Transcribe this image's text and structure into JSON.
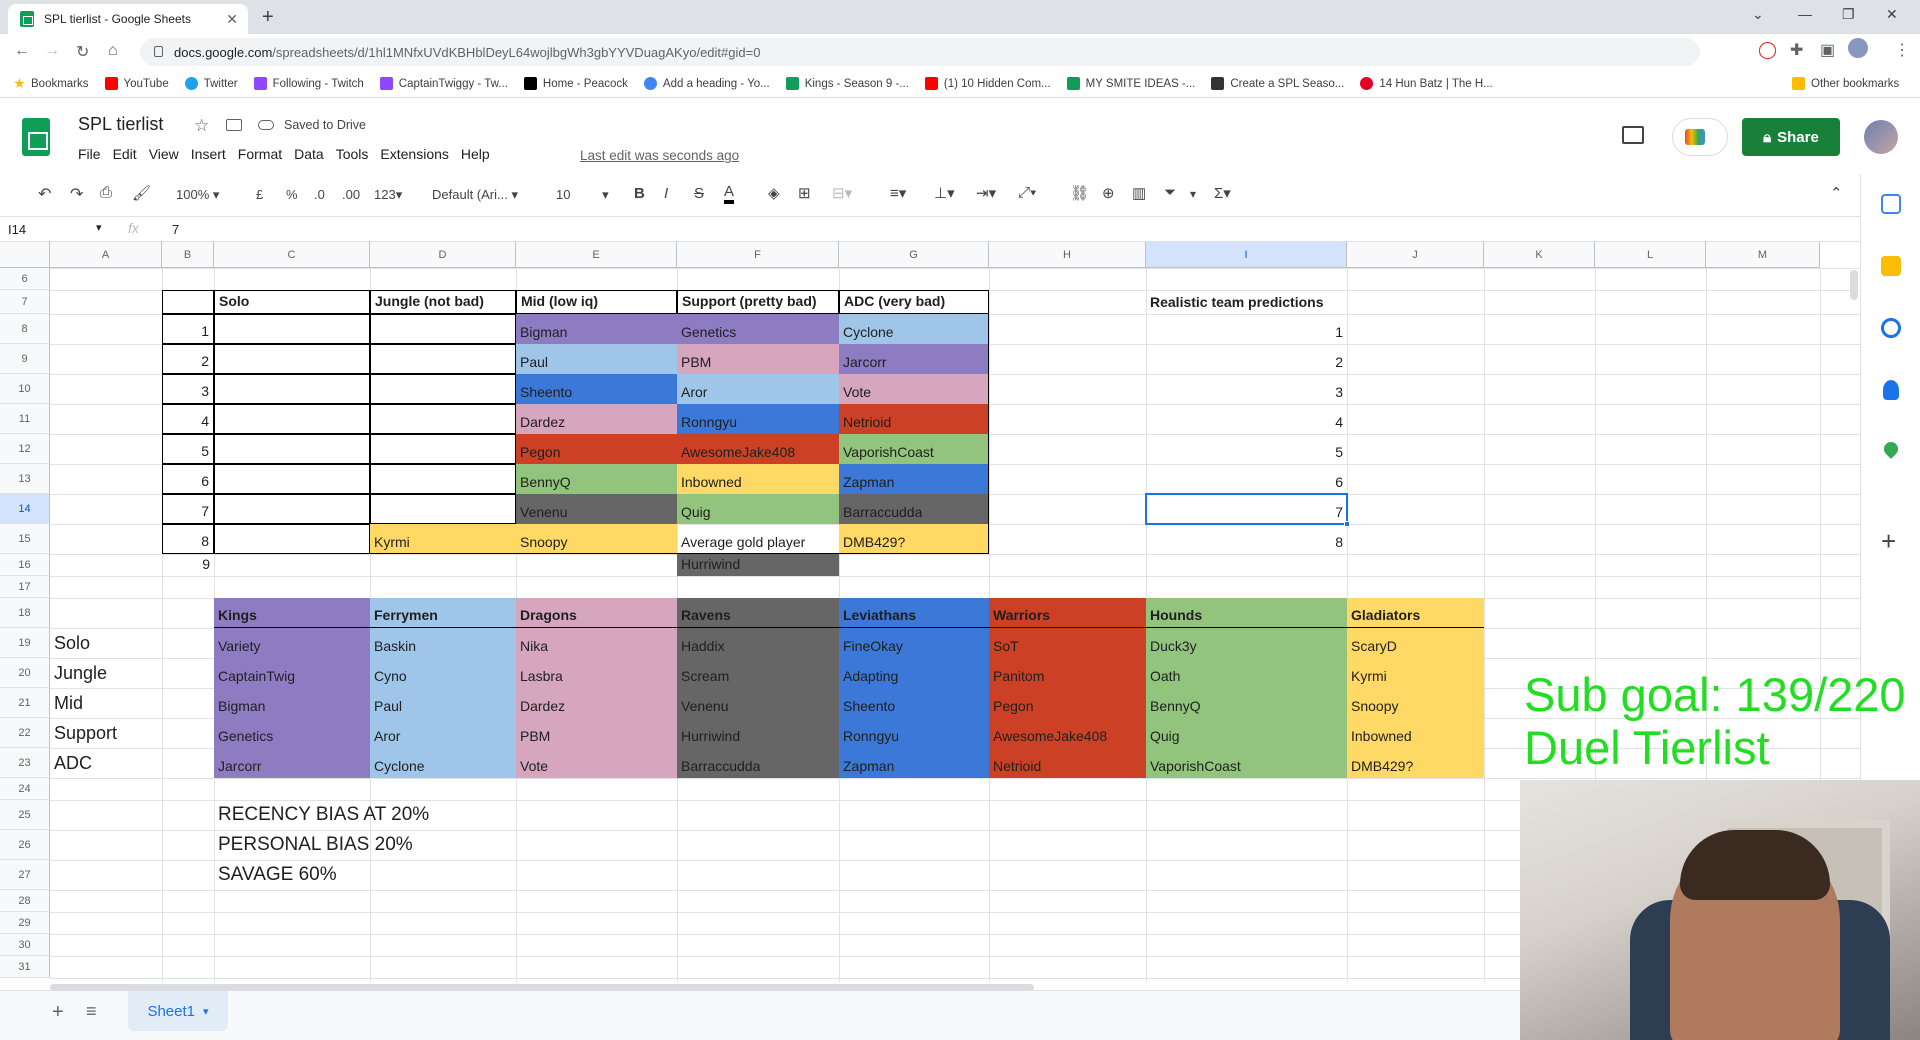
{
  "browser": {
    "tab_title": "SPL tierlist - Google Sheets",
    "url_host": "docs.google.com",
    "url_path": "/spreadsheets/d/1hl1MNfxUVdKBHblDeyL64wojlbgWh3gbYYVDuagAKyo/edit#gid=0",
    "bookmarks": [
      "Bookmarks",
      "YouTube",
      "Twitter",
      "Following - Twitch",
      "CaptainTwiggy - Tw...",
      "Home - Peacock",
      "Add a heading - Yo...",
      "Kings - Season 9 -...",
      "(1) 10 Hidden Com...",
      "MY SMITE IDEAS -...",
      "Create a SPL Seaso...",
      "14 Hun Batz | The H..."
    ],
    "other_bookmarks": "Other bookmarks"
  },
  "doc": {
    "title": "SPL tierlist",
    "saved": "Saved to Drive",
    "menu": [
      "File",
      "Edit",
      "View",
      "Insert",
      "Format",
      "Data",
      "Tools",
      "Extensions",
      "Help"
    ],
    "last_edit": "Last edit was seconds ago",
    "share": "Share"
  },
  "toolbar": {
    "zoom": "100%",
    "currency": "£",
    "percent": "%",
    "dec_less": ".0",
    "dec_more": ".00",
    "format": "123",
    "font": "Default (Ari...",
    "font_size": "10"
  },
  "formula": {
    "cell_ref": "I14",
    "fx": "fx",
    "value": "7"
  },
  "columns": [
    "A",
    "B",
    "C",
    "D",
    "E",
    "F",
    "G",
    "H",
    "I",
    "J",
    "K",
    "L",
    "M"
  ],
  "rows": [
    "6",
    "7",
    "8",
    "9",
    "10",
    "11",
    "12",
    "13",
    "14",
    "15",
    "16",
    "17",
    "18",
    "19",
    "20",
    "21",
    "22",
    "23",
    "24",
    "25",
    "26",
    "27",
    "28",
    "29",
    "30",
    "31"
  ],
  "tier_header": [
    "Solo",
    "Jungle (not bad)",
    "Mid (low iq)",
    "Support (pretty bad)",
    "ADC (very bad)"
  ],
  "tier_ranks": [
    "1",
    "2",
    "3",
    "4",
    "5",
    "6",
    "7",
    "8",
    "9"
  ],
  "tier": {
    "jungle": [
      "Kyrmi"
    ],
    "mid": [
      "Bigman",
      "Paul",
      "Sheento",
      "Dardez",
      "Pegon",
      "BennyQ",
      "Venenu",
      "Snoopy"
    ],
    "support": [
      "Genetics",
      "PBM",
      "Aror",
      "Ronngyu",
      "AwesomeJake408",
      "Inbowned",
      "Quig",
      "Average gold player",
      "Hurriwind"
    ],
    "adc": [
      "Cyclone",
      "Jarcorr",
      "Vote",
      "Netrioid",
      "VaporishCoast",
      "Zapman",
      "Barraccudda",
      "DMB429?"
    ]
  },
  "predictions": {
    "title": "Realistic team predictions",
    "values": [
      "1",
      "2",
      "3",
      "4",
      "5",
      "6",
      "7",
      "8"
    ]
  },
  "roles": [
    "Solo",
    "Jungle",
    "Mid",
    "Support",
    "ADC"
  ],
  "teams": [
    {
      "name": "Kings",
      "players": [
        "Variety",
        "CaptainTwig",
        "Bigman",
        "Genetics",
        "Jarcorr"
      ]
    },
    {
      "name": "Ferrymen",
      "players": [
        "Baskin",
        "Cyno",
        "Paul",
        "Aror",
        "Cyclone"
      ]
    },
    {
      "name": "Dragons",
      "players": [
        "Nika",
        "Lasbra",
        "Dardez",
        "PBM",
        "Vote"
      ]
    },
    {
      "name": "Ravens",
      "players": [
        "Haddix",
        "Scream",
        "Venenu",
        "Hurriwind",
        "Barraccudda"
      ]
    },
    {
      "name": "Leviathans",
      "players": [
        "FineOkay",
        "Adapting",
        "Sheento",
        "Ronngyu",
        "Zapman"
      ]
    },
    {
      "name": "Warriors",
      "players": [
        "SoT",
        "Panitom",
        "Pegon",
        "AwesomeJake408",
        "Netrioid"
      ]
    },
    {
      "name": "Hounds",
      "players": [
        "Duck3y",
        "Oath",
        "BennyQ",
        "Quig",
        "VaporishCoast"
      ]
    },
    {
      "name": "Gladiators",
      "players": [
        "ScaryD",
        "Kyrmi",
        "Snoopy",
        "Inbowned",
        "DMB429?"
      ]
    }
  ],
  "bias": [
    "RECENCY BIAS AT 20%",
    "PERSONAL BIAS 20%",
    "SAVAGE 60%"
  ],
  "sheet_tab": "Sheet1",
  "overlay": {
    "line1": "Sub goal: 139/220",
    "line2": "Duel Tierlist"
  },
  "colors": {
    "purple": "#8e7cc3",
    "light_blue": "#9fc5e8",
    "blue": "#3c78d8",
    "pink": "#d5a6bd",
    "red": "#cc4125",
    "green": "#93c47d",
    "yellow": "#ffd966",
    "gray": "#666666",
    "share": "#188038",
    "overlay_text": "#22dd22"
  }
}
